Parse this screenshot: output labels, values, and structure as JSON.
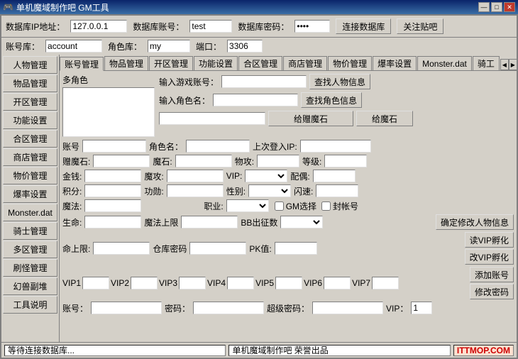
{
  "titleBar": {
    "title": "单机魔域制作吧 GM工具",
    "minBtn": "—",
    "maxBtn": "□",
    "closeBtn": "✕"
  },
  "topBar": {
    "dbIpLabel": "数据库IP地址：",
    "dbIp": "127.0.0.1",
    "dbAccountLabel": "数据库账号：",
    "dbAccount": "test",
    "dbPasswordLabel": "数据库密码：",
    "dbPassword": "****",
    "connectBtn": "连接数据库",
    "closeBtn": "关注贴吧"
  },
  "accountBar": {
    "accountLabel": "账号库：",
    "account": "account",
    "roleLabel": "角色库：",
    "role": "my",
    "portLabel": "端口：",
    "port": "3306"
  },
  "sidebar": {
    "items": [
      "人物管理",
      "物品管理",
      "开区管理",
      "功能设置",
      "合区管理",
      "商店管理",
      "物价管理",
      "爆率设置",
      "Monster.dat",
      "骑士管理",
      "多区管理",
      "刷怪管理",
      "幻兽副堆",
      "工具说明"
    ]
  },
  "tabs": [
    "账号管理",
    "物品管理",
    "开区管理",
    "功能设置",
    "合区管理",
    "商店管理",
    "物价管理",
    "爆率设置",
    "Monster.dat",
    "骑工"
  ],
  "form": {
    "multiCharLabel": "多角色",
    "searchAccountLabel": "输入游戏账号：",
    "searchRoleLabel": "输入角色名：",
    "findPersonBtn": "查找人物信息",
    "findRoleBtn": "查找角色信息",
    "giftMagicStoneBtn": "给赠魔石",
    "giveMagicStoneBtn": "给魔石",
    "accountLabel": "账号",
    "roleNameLabel": "角色名：",
    "lastLoginLabel": "上次登入IP:",
    "giftMagicStoneLabel": "赠魔石:",
    "magicStoneLabel": "魔石:",
    "physicalAtkLabel": "物攻:",
    "levelLabel": "等级:",
    "goldLabel": "金钱:",
    "magicAtkLabel": "魔攻:",
    "vipLabel": "VIP:",
    "spouseLabel": "配偶:",
    "scoreLabel": "积分:",
    "meritLabel": "功勋:",
    "sexLabel": "性别:",
    "flashLabel": "闪速:",
    "magicLabel": "魔法:",
    "jobLabel": "职业:",
    "gmSelectLabel": "GM选择",
    "sealLabel": "封帐号",
    "confirmBtn": "确定修改人物信息",
    "hpLabel": "生命:",
    "magicMaxLabel": "魔法上限",
    "bbExpLabel": "BB出征数",
    "maxHpLabel": "命上限:",
    "warehouseLabel": "仓库密码",
    "pkLabel": "PK值:",
    "vipEvolveBtn": "读VIP孵化",
    "changeVipEvolveBtn": "改VIP孵化",
    "addAccountBtn": "添加账号",
    "changePasswordBtn": "修改密码",
    "vip1Label": "VIP1",
    "vip2Label": "VIP2",
    "vip3Label": "VIP3",
    "vip4Label": "VIP4",
    "vip5Label": "VIP5",
    "vip6Label": "VIP6",
    "vip7Label": "VIP7",
    "bottomAccountLabel": "账号：",
    "passwordLabel": "密码：",
    "superPasswordLabel": "超级密码：",
    "vipBottomLabel": "VIP：",
    "vipValue": "1"
  },
  "statusBar": {
    "waitText": "等待连接数据库...",
    "creditText": "单机魔域制作吧 荣誉出品",
    "watermark": "ITTMOP.COM"
  },
  "colors": {
    "windowBg": "#d4d0c8",
    "titleBg": "#0a246a",
    "inputBg": "#ffffff",
    "selectBg": "#c8c8ff"
  }
}
